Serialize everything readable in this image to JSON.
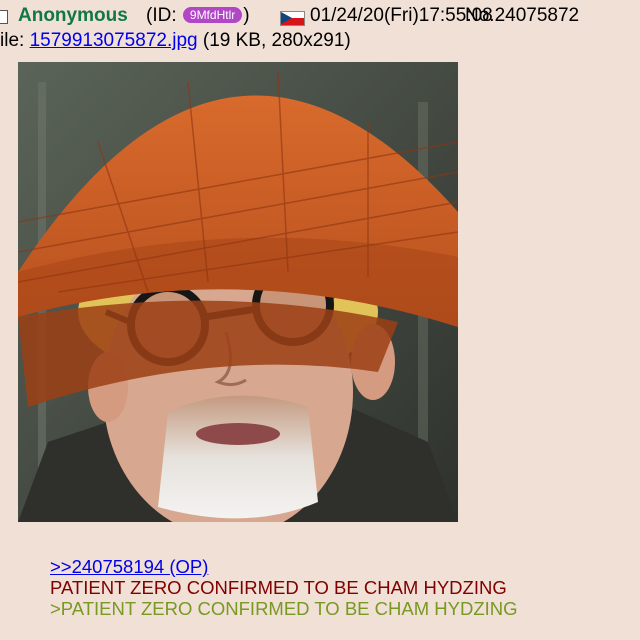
{
  "post": {
    "name": "Anonymous",
    "id_prefix": "(ID:",
    "id": "9MfdHtlr",
    "id_suffix": ")",
    "flag_icon": "czech-flag-icon",
    "datetime": "01/24/20(Fri)17:55:08",
    "number": "No.24075872",
    "file_prefix": "ile:",
    "file_name": "1579913075872.jpg",
    "file_info": "(19 KB, 280x291)",
    "image_icon": "post-image-man-with-conical-hat",
    "quote_link": ">>240758194 (OP)",
    "text_line": "PATIENT ZERO CONFIRMED TO BE CHAM HYDZING",
    "greentext_line": ">PATIENT ZERO CONFIRMED TO BE CHAM HYDZING"
  },
  "colors": {
    "background": "#f0e0d6",
    "name": "#117743",
    "id_badge": "#b146c7",
    "link": "#0000ee",
    "text": "#800000",
    "greentext": "#789922"
  }
}
